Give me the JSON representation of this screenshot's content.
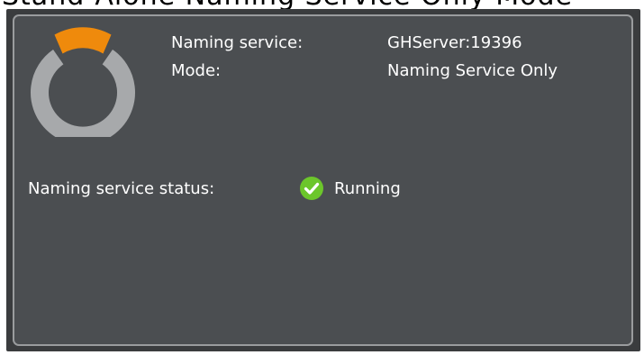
{
  "top_banner": {
    "text": "Stand-Alone Naming Service Only Mode"
  },
  "logo": {
    "icon": "naming-service-logo-icon",
    "accent_color": "#ef8a0c",
    "ring_color": "#a7a9ab"
  },
  "info": {
    "naming_service_label": "Naming service:",
    "naming_service_value": "GHServer:19396",
    "mode_label": "Mode:",
    "mode_value": "Naming Service Only"
  },
  "status": {
    "label": "Naming service status:",
    "value": "Running",
    "icon": "check-circle-icon",
    "color": "#6cc62b"
  }
}
